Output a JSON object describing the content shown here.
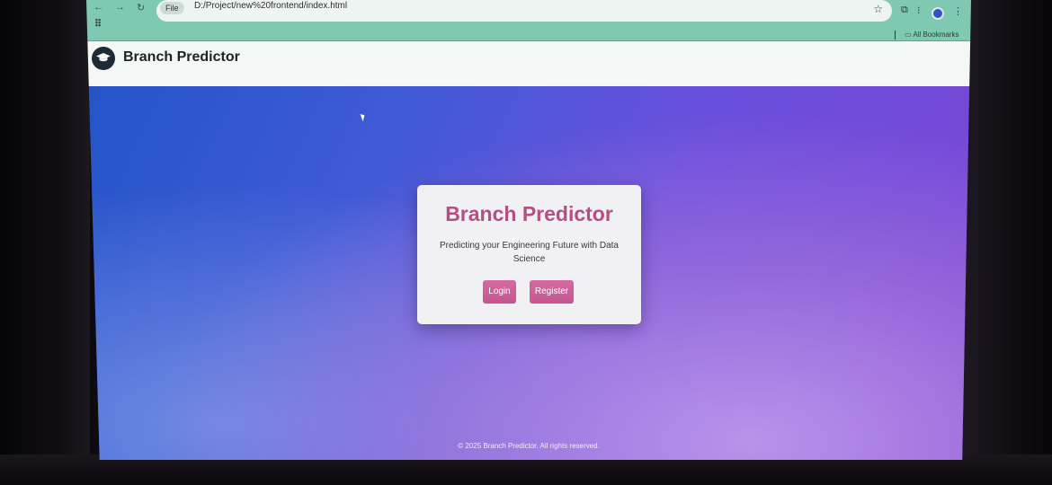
{
  "browser": {
    "file_chip": "File",
    "url": "D:/Project/new%20frontend/index.html",
    "all_bookmarks": "All Bookmarks"
  },
  "header": {
    "title": "Branch Predictor",
    "logo_icon": "graduation-cap-icon"
  },
  "card": {
    "title": "Branch Predictor",
    "subtitle": "Predicting your Engineering Future with Data Science",
    "login_label": "Login",
    "register_label": "Register"
  },
  "footer": {
    "text": "© 2025 Branch Predictor. All rights reserved."
  },
  "colors": {
    "accent": "#c45590",
    "title_pink": "#b44f86",
    "browser_chrome": "#7fc9b2",
    "gradient_start": "#2554c8",
    "gradient_end": "#7b45d6"
  }
}
